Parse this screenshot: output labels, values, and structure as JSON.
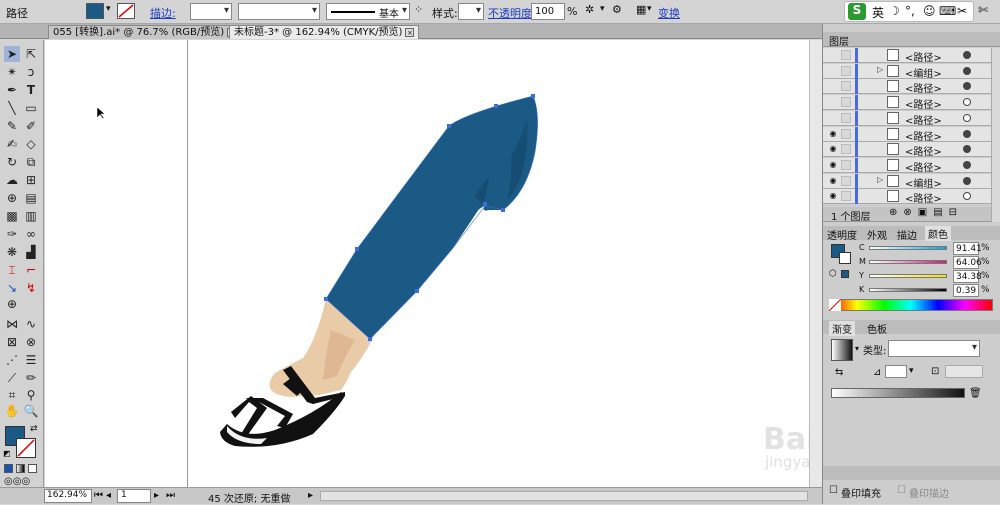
{
  "control_bar": {
    "label_path": "路径",
    "label_stroke": "描边:",
    "label_basic": "基本",
    "label_style": "样式:",
    "label_opacity": "不透明度:",
    "opacity_value": "100",
    "opacity_unit": "%",
    "label_transform": "变换",
    "fill_color": "#1a5a85"
  },
  "ime": {
    "logo": "S",
    "lang": "英"
  },
  "tabs": [
    {
      "label": "055 [转换].ai* @ 76.7% (RGB/预览)"
    },
    {
      "label": "未标题-3* @ 162.94% (CMYK/预览)"
    }
  ],
  "status": {
    "zoom": "162.94%",
    "page": "1",
    "undo_text": "45 次还原; 无重做"
  },
  "layers_panel": {
    "title": "图层",
    "rows": [
      {
        "name": "<路径>",
        "eye": false,
        "group": false,
        "target": "filled"
      },
      {
        "name": "<编组>",
        "eye": false,
        "group": true,
        "target": "filled"
      },
      {
        "name": "<路径>",
        "eye": false,
        "group": false,
        "target": "filled"
      },
      {
        "name": "<路径>",
        "eye": false,
        "group": false,
        "target": "open"
      },
      {
        "name": "<路径>",
        "eye": false,
        "group": false,
        "target": "open"
      },
      {
        "name": "<路径>",
        "eye": true,
        "group": false,
        "target": "filled"
      },
      {
        "name": "<路径>",
        "eye": true,
        "group": false,
        "target": "filled"
      },
      {
        "name": "<路径>",
        "eye": true,
        "group": false,
        "target": "filled"
      },
      {
        "name": "<编组>",
        "eye": true,
        "group": true,
        "target": "filled"
      },
      {
        "name": "<路径>",
        "eye": true,
        "group": false,
        "target": "open"
      }
    ],
    "footer": "1 个图层"
  },
  "color_panel": {
    "tabs": [
      "透明度",
      "外观",
      "描边",
      "颜色"
    ],
    "channels": [
      {
        "label": "C",
        "value": "91.41"
      },
      {
        "label": "M",
        "value": "64.06"
      },
      {
        "label": "Y",
        "value": "34.38"
      },
      {
        "label": "K",
        "value": "0.39"
      }
    ],
    "unit": "%"
  },
  "gradient_panel": {
    "tabs": [
      "渐变",
      "色板"
    ],
    "type_label": "类型:"
  },
  "bottom_checks": {
    "overprint_fill": "叠印填充",
    "overprint_stroke": "叠印描边"
  },
  "watermark": {
    "text": "Bai 经验",
    "url": "jingyan.baidu.com"
  }
}
